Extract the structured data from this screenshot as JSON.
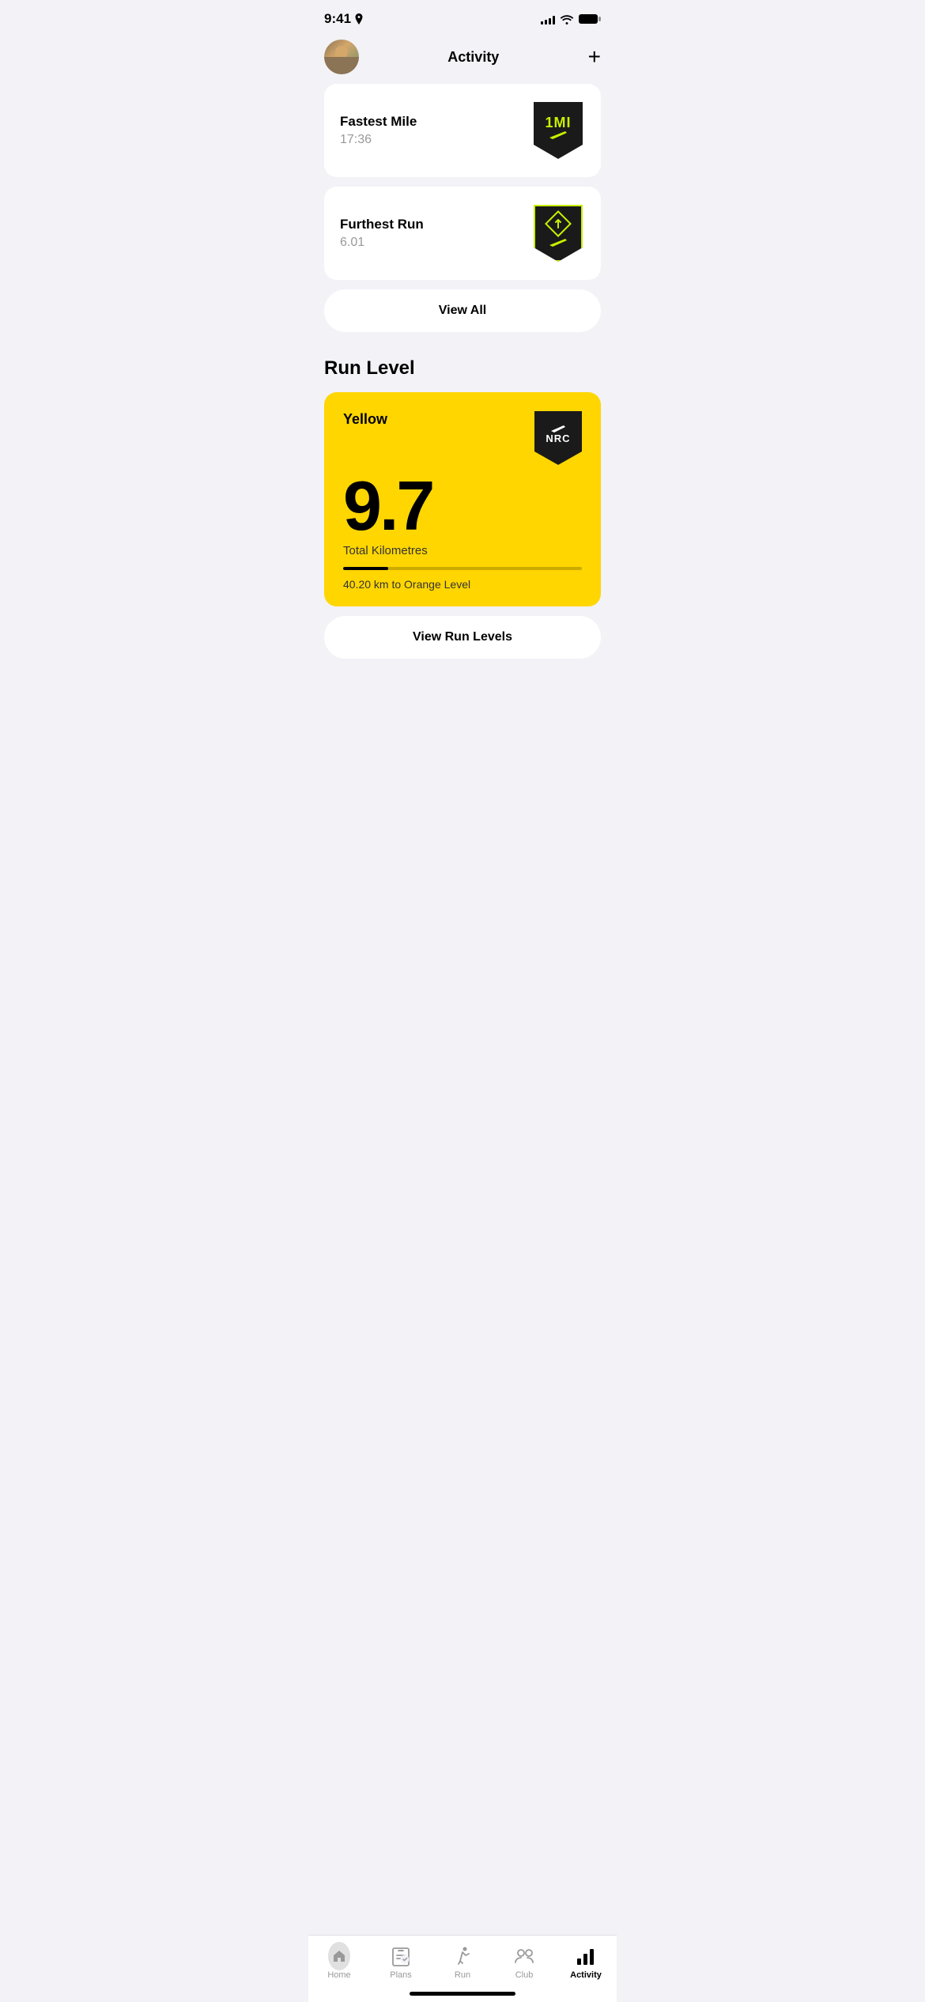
{
  "statusBar": {
    "time": "9:41",
    "signalBars": [
      4,
      6,
      8,
      10,
      12
    ],
    "hasLocation": true
  },
  "header": {
    "title": "Activity",
    "addLabel": "+"
  },
  "achievements": [
    {
      "title": "Fastest Mile",
      "value": "17:36",
      "badgeType": "mile"
    },
    {
      "title": "Furthest Run",
      "value": "6.01",
      "badgeType": "distance"
    }
  ],
  "viewAllLabel": "View All",
  "runLevel": {
    "sectionTitle": "Run Level",
    "levelName": "Yellow",
    "levelNumber": "9.7",
    "levelDesc": "Total Kilometres",
    "progressPercent": 19,
    "nextLevelText": "40.20 km to Orange Level"
  },
  "viewRunLevelsLabel": "View Run Levels",
  "bottomNav": {
    "items": [
      {
        "id": "home",
        "label": "Home",
        "active": false
      },
      {
        "id": "plans",
        "label": "Plans",
        "active": false
      },
      {
        "id": "run",
        "label": "Run",
        "active": false
      },
      {
        "id": "club",
        "label": "Club",
        "active": false
      },
      {
        "id": "activity",
        "label": "Activity",
        "active": true
      }
    ]
  }
}
